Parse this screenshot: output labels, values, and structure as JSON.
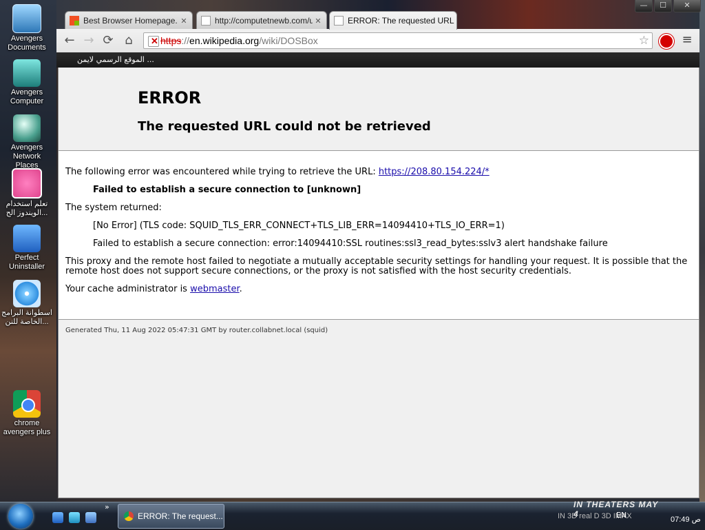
{
  "desktop": {
    "icons": [
      {
        "label": "Avengers Documents",
        "icon": "folder-icon"
      },
      {
        "label": "Avengers Computer",
        "icon": "computer-icon"
      },
      {
        "label": "Avengers Network Places",
        "icon": "network-icon"
      },
      {
        "label": "تعلم استخدام الويندوز الج...",
        "icon": "dribbble-icon"
      },
      {
        "label": "Perfect Uninstaller",
        "icon": "uninstaller-icon"
      },
      {
        "label": "اسطوانة البرامج الخاصة للنن...",
        "icon": "cd-icon"
      },
      {
        "label": "chrome avengers plus",
        "icon": "chrome-icon"
      }
    ]
  },
  "window": {
    "controls": [
      "—",
      "☐",
      "✕"
    ]
  },
  "tabs": [
    {
      "title": "Best Browser Homepage. Cu",
      "icon": "microsoft-icon",
      "active": false
    },
    {
      "title": "http://computetnewb.com/u",
      "icon": "page-icon",
      "active": false
    },
    {
      "title": "ERROR: The requested URL",
      "icon": "page-icon",
      "active": true
    }
  ],
  "toolbar": {
    "back": "←",
    "forward": "→",
    "reload": "⟳",
    "home": "⌂",
    "url_scheme": "https",
    "url_sep": "://",
    "url_host": "en.wikipedia.org",
    "url_path": "/wiki/DOSBox",
    "star": "☆",
    "menu": "≡"
  },
  "bookmarks": {
    "item": "الموقع الرسمي لايمن ..."
  },
  "page": {
    "heading": "ERROR",
    "subheading": "The requested URL could not be retrieved",
    "line1_text": "The following error was encountered while trying to retrieve the URL: ",
    "line1_link": "https://208.80.154.224/*",
    "failed": "Failed to establish a secure connection to [unknown]",
    "system_returned": "The system returned:",
    "no_error": "[No Error] (TLS code: SQUID_TLS_ERR_CONNECT+TLS_LIB_ERR=14094410+TLS_IO_ERR=1)",
    "ssl_error": "Failed to establish a secure connection: error:14094410:SSL routines:ssl3_read_bytes:sslv3 alert handshake failure",
    "proxy_1": "This proxy and the remote host failed to negotiate a mutually acceptable security settings for handling your request. It is possible that the",
    "proxy_2": "remote host does not support secure connections, or the proxy is not satisfied with the host security credentials.",
    "cache_admin": "Your cache administrator is ",
    "webmaster": "webmaster",
    "period": ".",
    "footer": "Generated Thu, 11 Aug 2022 05:47:31 GMT by router.collabnet.local (squid)"
  },
  "taskbar": {
    "arrow": "»",
    "task_label": "ERROR: The request...",
    "ad_line1": "IN THEATERS MAY 4",
    "ad_line2": "IN 3D  real D 3D  IMAX",
    "language": "EN",
    "time": "07:49 ص"
  }
}
